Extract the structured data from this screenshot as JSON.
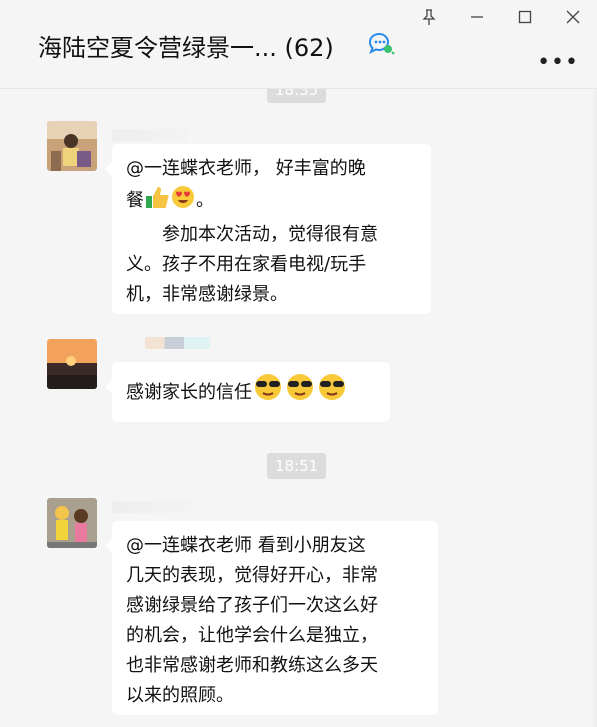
{
  "window": {
    "pin_label": "⚲",
    "minimize_label": "–",
    "maximize_label": "☐",
    "close_label": "✕"
  },
  "header": {
    "title": "海陆空夏令营绿景一... (62)",
    "more_label": "•••"
  },
  "messages": [
    {
      "type": "time",
      "text": "18:35"
    },
    {
      "type": "msg",
      "lines": [
        "@一连蝶衣老师， 好丰富的晚",
        "餐",
        "　　参加本次活动，觉得很有意",
        "义。孩子不用在家看电视/玩手",
        "机，非常感谢绿景。"
      ]
    },
    {
      "type": "msg",
      "lines": [
        "感谢家长的信任"
      ]
    },
    {
      "type": "time",
      "text": "18:51"
    },
    {
      "type": "msg",
      "lines": [
        "@一连蝶衣老师 看到小朋友这",
        "几天的表现，觉得好开心，非常",
        "感谢绿景给了孩子们一次这么好",
        "的机会，让他学会什么是独立，",
        "也非常感谢老师和教练这么多天",
        "以来的照顾。"
      ]
    }
  ],
  "colors": {
    "bubble": "#ffffff",
    "background": "#f5f5f5",
    "time_pill": "#dcdcdc"
  }
}
